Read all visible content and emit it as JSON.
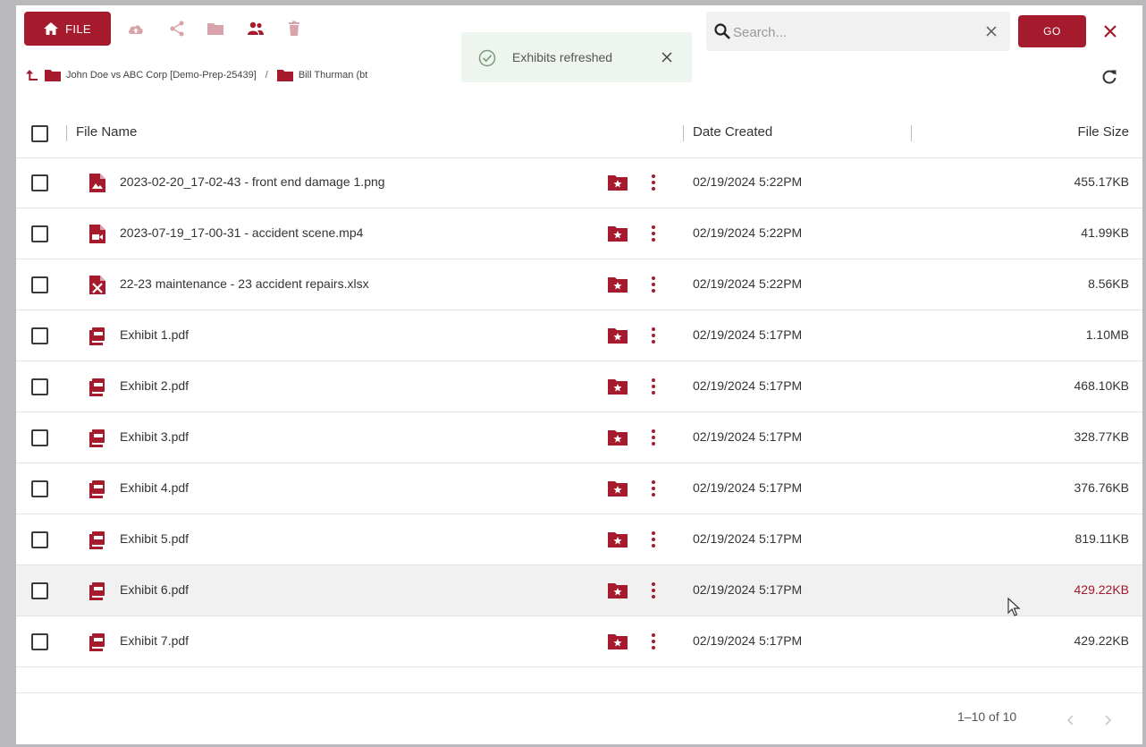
{
  "toolbar": {
    "file_label": "FILE"
  },
  "search": {
    "placeholder": "Search...",
    "value": "",
    "go_label": "GO"
  },
  "breadcrumb": {
    "items": [
      "John Doe vs ABC Corp [Demo-Prep-25439]",
      "Bill Thurman (bt"
    ],
    "separator": "/"
  },
  "toast": {
    "message": "Exhibits refreshed"
  },
  "table": {
    "columns": {
      "name": "File Name",
      "date": "Date Created",
      "size": "File Size"
    },
    "rows": [
      {
        "name": "2023-02-20_17-02-43 - front end damage 1.png",
        "date": "02/19/2024 5:22PM",
        "size": "455.17KB",
        "type": "image"
      },
      {
        "name": "2023-07-19_17-00-31 - accident scene.mp4",
        "date": "02/19/2024 5:22PM",
        "size": "41.99KB",
        "type": "video"
      },
      {
        "name": "22-23 maintenance - 23 accident repairs.xlsx",
        "date": "02/19/2024 5:22PM",
        "size": "8.56KB",
        "type": "excel"
      },
      {
        "name": "Exhibit 1.pdf",
        "date": "02/19/2024 5:17PM",
        "size": "1.10MB",
        "type": "pdf"
      },
      {
        "name": "Exhibit 2.pdf",
        "date": "02/19/2024 5:17PM",
        "size": "468.10KB",
        "type": "pdf"
      },
      {
        "name": "Exhibit 3.pdf",
        "date": "02/19/2024 5:17PM",
        "size": "328.77KB",
        "type": "pdf"
      },
      {
        "name": "Exhibit 4.pdf",
        "date": "02/19/2024 5:17PM",
        "size": "376.76KB",
        "type": "pdf"
      },
      {
        "name": "Exhibit 5.pdf",
        "date": "02/19/2024 5:17PM",
        "size": "819.11KB",
        "type": "pdf"
      },
      {
        "name": "Exhibit 6.pdf",
        "date": "02/19/2024 5:17PM",
        "size": "429.22KB",
        "type": "pdf"
      },
      {
        "name": "Exhibit 7.pdf",
        "date": "02/19/2024 5:17PM",
        "size": "429.22KB",
        "type": "pdf"
      }
    ]
  },
  "pagination": {
    "range": "1–10 of 10"
  },
  "colors": {
    "accent": "#a61a2e",
    "hover_row": "#f1f1f1",
    "toast_bg": "#eef4ee"
  },
  "icons": [
    "home-icon",
    "cloud-upload-icon",
    "share-icon",
    "folder-icon",
    "people-icon",
    "trash-icon",
    "search-icon",
    "clear-icon",
    "close-icon",
    "up-arrow-icon",
    "folder-icon",
    "refresh-icon",
    "check-circle-icon",
    "favorite-folder-icon",
    "kebab-menu-icon",
    "chevron-left-icon",
    "chevron-right-icon"
  ]
}
